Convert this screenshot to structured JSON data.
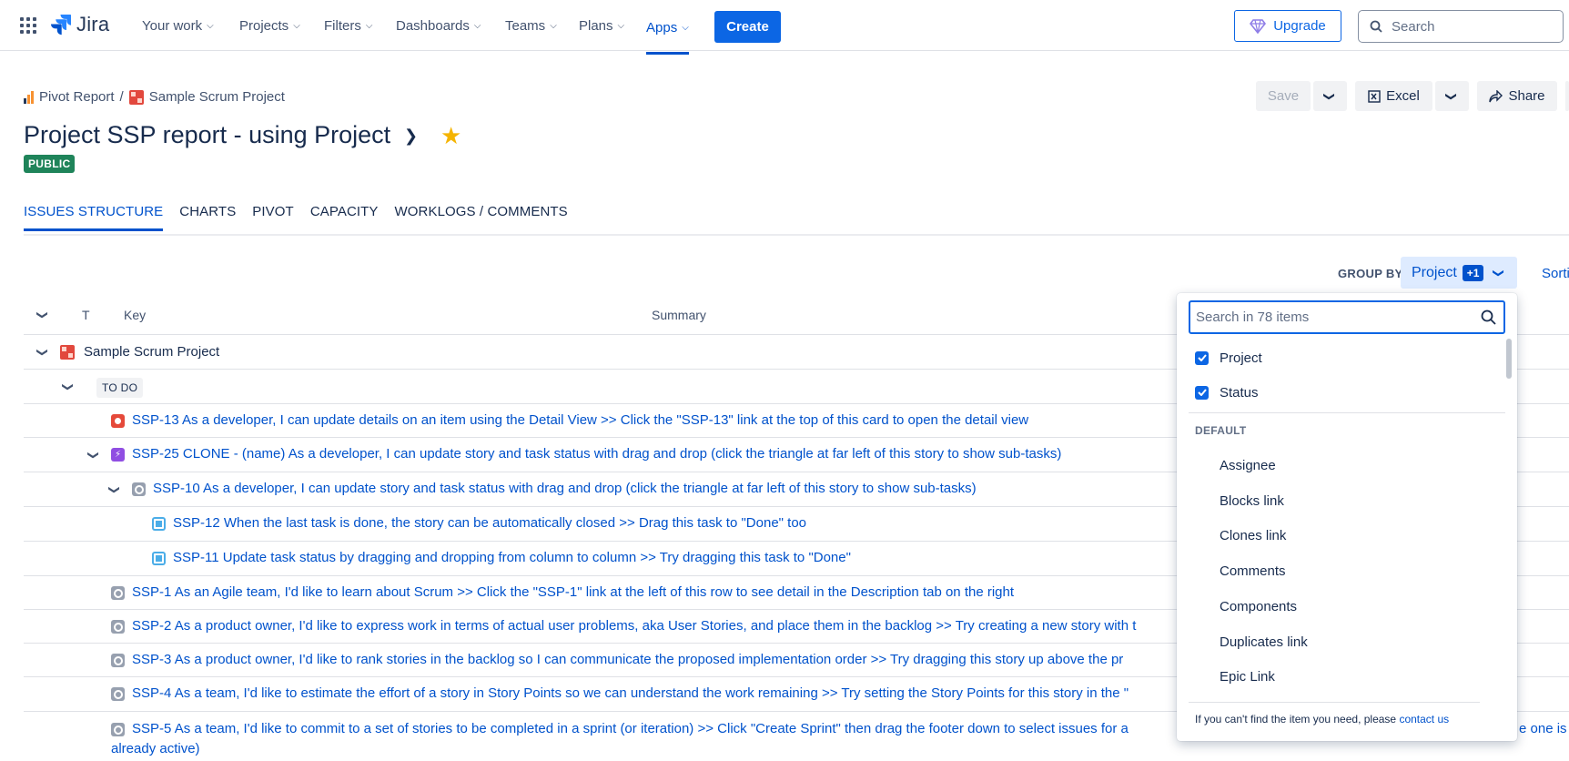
{
  "nav": {
    "logo": "Jira",
    "items": [
      {
        "label": "Your work"
      },
      {
        "label": "Projects"
      },
      {
        "label": "Filters"
      },
      {
        "label": "Dashboards"
      },
      {
        "label": "Teams"
      },
      {
        "label": "Plans"
      },
      {
        "label": "Apps"
      }
    ],
    "create": "Create",
    "upgrade": "Upgrade",
    "search_placeholder": "Search"
  },
  "breadcrumb": {
    "root": "Pivot Report",
    "separator": "/",
    "project": "Sample Scrum Project"
  },
  "page": {
    "title": "Project SSP report - using Project",
    "badge": "PUBLIC"
  },
  "toolbar": {
    "save": "Save",
    "excel": "Excel",
    "share": "Share"
  },
  "tabs": [
    {
      "label": "ISSUES STRUCTURE"
    },
    {
      "label": "CHARTS"
    },
    {
      "label": "PIVOT"
    },
    {
      "label": "CAPACITY"
    },
    {
      "label": "WORKLOGS / COMMENTS"
    }
  ],
  "groupby": {
    "label": "GROUP BY",
    "value": "Project",
    "extra": "+1",
    "sort": "Sorti"
  },
  "table": {
    "headers": {
      "type": "T",
      "key": "Key",
      "summary": "Summary"
    },
    "project_row": "Sample Scrum Project",
    "status_row": "TO DO",
    "rows": [
      {
        "text": "SSP-13 As a developer, I can update details on an item using the Detail View >> Click the \"SSP-13\" link at the top of this card to open the detail view"
      },
      {
        "text": "SSP-25 CLONE - (name) As a developer, I can update story and task status with drag and drop (click the triangle at far left of this story to show sub-tasks)"
      },
      {
        "text": "SSP-10 As a developer, I can update story and task status with drag and drop (click the triangle at far left of this story to show sub-tasks)"
      },
      {
        "text": "SSP-12 When the last task is done, the story can be automatically closed >> Drag this task to \"Done\" too"
      },
      {
        "text": "SSP-11 Update task status by dragging and dropping from column to column >> Try dragging this task to \"Done\""
      },
      {
        "text": "SSP-1 As an Agile team, I'd like to learn about Scrum >> Click the \"SSP-1\" link at the left of this row to see detail in the Description tab on the right"
      },
      {
        "text": "SSP-2 As a product owner, I'd like to express work in terms of actual user problems, aka User Stories, and place them in the backlog >> Try creating a new story with t"
      },
      {
        "text": "SSP-3 As a product owner, I'd like to rank stories in the backlog so I can communicate the proposed implementation order >> Try dragging this story up above the pr"
      },
      {
        "text": "SSP-4 As a team, I'd like to estimate the effort of a story in Story Points so we can understand the work remaining >> Try setting the Story Points for this story in the \""
      },
      {
        "text": "SSP-5 As a team, I'd like to commit to a set of stories to be completed in a sprint (or iteration) >> Click \"Create Sprint\" then drag the footer down to select issues for a",
        "tail": "e one is",
        "line2": "already active)"
      }
    ]
  },
  "dropdown": {
    "search_placeholder": "Search in 78 items",
    "selected": [
      {
        "label": "Project"
      },
      {
        "label": "Status"
      }
    ],
    "section": "DEFAULT",
    "options": [
      {
        "label": "Assignee"
      },
      {
        "label": "Blocks link"
      },
      {
        "label": "Clones link"
      },
      {
        "label": "Comments"
      },
      {
        "label": "Components"
      },
      {
        "label": "Duplicates link"
      },
      {
        "label": "Epic Link"
      }
    ],
    "footer_text": "If you can't find the item you need, please",
    "footer_link": "contact us"
  }
}
